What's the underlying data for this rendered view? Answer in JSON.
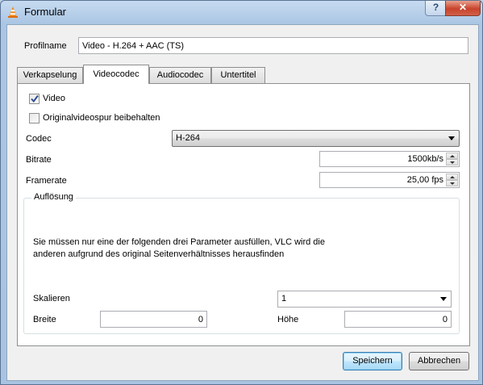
{
  "window": {
    "title": "Formular",
    "help_label": "?",
    "close_label": "✕",
    "icon": "vlc-cone-icon"
  },
  "profile": {
    "label": "Profilname",
    "value": "Video - H.264 + AAC (TS)"
  },
  "tabs": [
    {
      "label": "Verkapselung",
      "active": false
    },
    {
      "label": "Videocodec",
      "active": true
    },
    {
      "label": "Audiocodec",
      "active": false
    },
    {
      "label": "Untertitel",
      "active": false
    }
  ],
  "videocodec": {
    "video_checkbox": {
      "label": "Video",
      "checked": true
    },
    "keep_original_checkbox": {
      "label": "Originalvideospur beibehalten",
      "checked": false
    },
    "codec": {
      "label": "Codec",
      "value": "H-264"
    },
    "bitrate": {
      "label": "Bitrate",
      "value": "1500kb/s"
    },
    "framerate": {
      "label": "Framerate",
      "value": "25,00 fps"
    },
    "resolution": {
      "title": "Auflösung",
      "info": "Sie müssen nur eine der folgenden drei Parameter ausfüllen, VLC wird die\nanderen aufgrund des original Seitenverhältnisses herausfinden",
      "scale": {
        "label": "Skalieren",
        "value": "1"
      },
      "width": {
        "label": "Breite",
        "value": "0"
      },
      "height": {
        "label": "Höhe",
        "value": "0"
      }
    }
  },
  "buttons": {
    "save": "Speichern",
    "cancel": "Abbrechen"
  },
  "colors": {
    "titlebar": "#aac6e4",
    "close_button": "#c8432b",
    "default_button_border": "#3c7fb1"
  }
}
